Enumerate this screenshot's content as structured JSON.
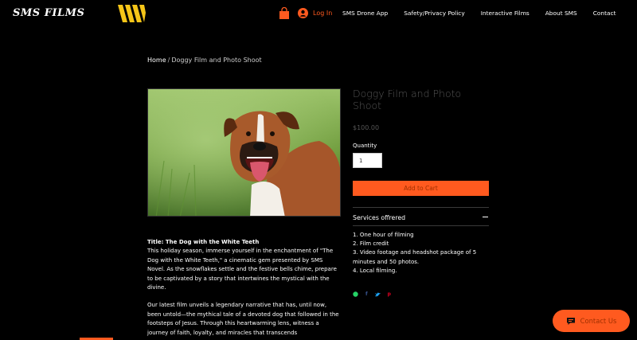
{
  "header": {
    "brand": "SMS FILMS",
    "login_label": "Log In",
    "nav": [
      "SMS Drone App",
      "Safety/Privacy Policy",
      "Interactive Films",
      "About SMS",
      "Contact"
    ]
  },
  "breadcrumb": {
    "home": "Home",
    "separator": "/",
    "current": "Doggy Film and Photo Shoot"
  },
  "product": {
    "title": "Doggy Film and Photo Shoot",
    "price": "$100.00",
    "quantity_label": "Quantity",
    "quantity_value": "1",
    "add_to_cart": "Add to Cart",
    "services_heading": "Services offrered",
    "services": [
      "1. One hour of filming",
      "2. Film credit",
      "3. Video footage and headshot package of 5 minutes and 50 photos.",
      "4. Local filming."
    ],
    "share_icons": [
      "whatsapp-icon",
      "facebook-icon",
      "twitter-icon",
      "pinterest-icon"
    ]
  },
  "description": {
    "title": "Title: The Dog with the White Teeth",
    "paragraph1": "This holiday season, immerse yourself in the enchantment of \"The Dog with the White Teeth,\" a cinematic gem presented by SMS Novel. As the snowflakes settle and the festive bells chime, prepare to be captivated by a story that intertwines the mystical with the divine.",
    "paragraph2": "Our latest film unveils a legendary narrative that has, until now, been untold—the mythical tale of a devoted dog that followed in the footsteps of Jesus. Through this heartwarming lens, witness a journey of faith, loyalty, and miracles that transcends"
  },
  "contact_button": "Contact Us",
  "colors": {
    "accent": "#ff5a1f",
    "logo_yellow": "#f5c518",
    "background": "#000000"
  }
}
